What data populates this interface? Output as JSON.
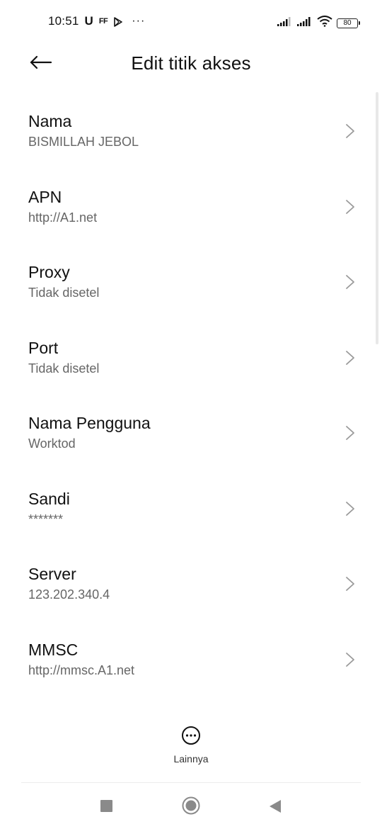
{
  "status_bar": {
    "time": "10:51",
    "notification_u": "U",
    "notification_ff": "FF",
    "more_dots": "···",
    "battery_level": "80"
  },
  "header": {
    "title": "Edit titik akses"
  },
  "settings": [
    {
      "title": "Nama",
      "value": "BISMILLAH JEBOL"
    },
    {
      "title": "APN",
      "value": "http://A1.net"
    },
    {
      "title": "Proxy",
      "value": "Tidak disetel"
    },
    {
      "title": "Port",
      "value": "Tidak disetel"
    },
    {
      "title": "Nama Pengguna",
      "value": "Worktod"
    },
    {
      "title": "Sandi",
      "value": "*******"
    },
    {
      "title": "Server",
      "value": "123.202.340.4"
    },
    {
      "title": "MMSC",
      "value": "http://mmsc.A1.net"
    }
  ],
  "more_action": {
    "label": "Lainnya"
  },
  "icons": {
    "back": "arrow-left-icon",
    "chevron": "chevron-right-icon",
    "more": "more-horizontal-icon",
    "nav_recents": "square-icon",
    "nav_home": "circle-icon",
    "nav_back": "triangle-icon"
  }
}
